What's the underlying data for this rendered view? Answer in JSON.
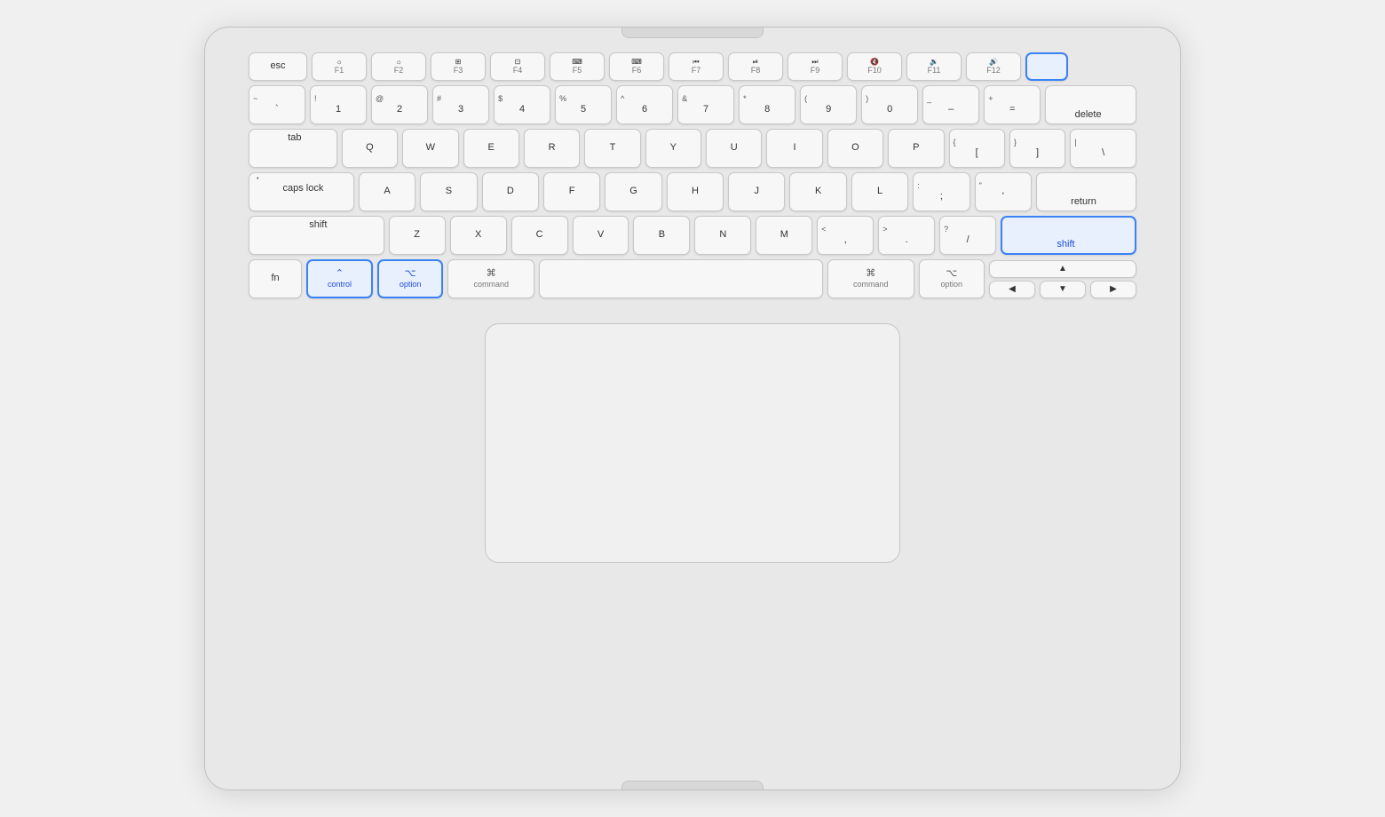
{
  "laptop": {
    "keyboard": {
      "rows": {
        "fn_row": [
          {
            "id": "esc",
            "label": "esc",
            "wide": true
          },
          {
            "id": "f1",
            "top": "☀",
            "label": "F1"
          },
          {
            "id": "f2",
            "top": "☀",
            "label": "F2"
          },
          {
            "id": "f3",
            "top": "⊞",
            "label": "F3"
          },
          {
            "id": "f4",
            "top": "⊟",
            "label": "F4"
          },
          {
            "id": "f5",
            "top": "",
            "label": "F5"
          },
          {
            "id": "f6",
            "top": "",
            "label": "F6"
          },
          {
            "id": "f7",
            "top": "⏪",
            "label": "F7"
          },
          {
            "id": "f8",
            "top": "⏯",
            "label": "F8"
          },
          {
            "id": "f9",
            "top": "⏩",
            "label": "F9"
          },
          {
            "id": "f10",
            "top": "🔇",
            "label": "F10"
          },
          {
            "id": "f11",
            "top": "🔉",
            "label": "F11"
          },
          {
            "id": "f12",
            "top": "🔊",
            "label": "F12"
          },
          {
            "id": "power",
            "label": "",
            "highlighted": true
          }
        ],
        "number_row": [
          {
            "id": "tilde",
            "top": "~",
            "label": "`"
          },
          {
            "id": "1",
            "top": "!",
            "label": "1"
          },
          {
            "id": "2",
            "top": "@",
            "label": "2"
          },
          {
            "id": "3",
            "top": "#",
            "label": "3"
          },
          {
            "id": "4",
            "top": "$",
            "label": "4"
          },
          {
            "id": "5",
            "top": "%",
            "label": "5"
          },
          {
            "id": "6",
            "top": "^",
            "label": "6"
          },
          {
            "id": "7",
            "top": "&",
            "label": "7"
          },
          {
            "id": "8",
            "top": "*",
            "label": "8"
          },
          {
            "id": "9",
            "top": "(",
            "label": "9"
          },
          {
            "id": "0",
            "top": ")",
            "label": "0"
          },
          {
            "id": "minus",
            "top": "_",
            "label": "–"
          },
          {
            "id": "equals",
            "top": "+",
            "label": "="
          },
          {
            "id": "delete",
            "label": "delete",
            "wide": true
          }
        ]
      },
      "highlighted_keys": [
        "power",
        "shift_r",
        "control",
        "option"
      ],
      "labels": {
        "esc": "esc",
        "tab": "tab",
        "caps_lock": "caps lock",
        "shift": "shift",
        "fn": "fn",
        "control": "control",
        "option": "option",
        "command": "command",
        "delete": "delete",
        "return": "return",
        "space": "",
        "q": "Q",
        "w": "W",
        "e": "E",
        "r": "R",
        "t": "T",
        "y": "Y",
        "u": "U",
        "i": "I",
        "o": "O",
        "p": "P",
        "a": "A",
        "s": "S",
        "d": "D",
        "f": "F",
        "g": "G",
        "h": "H",
        "j": "J",
        "k": "K",
        "l": "L",
        "z": "Z",
        "x": "X",
        "c": "C",
        "v": "V",
        "b": "B",
        "n": "N",
        "m": "M"
      }
    }
  }
}
